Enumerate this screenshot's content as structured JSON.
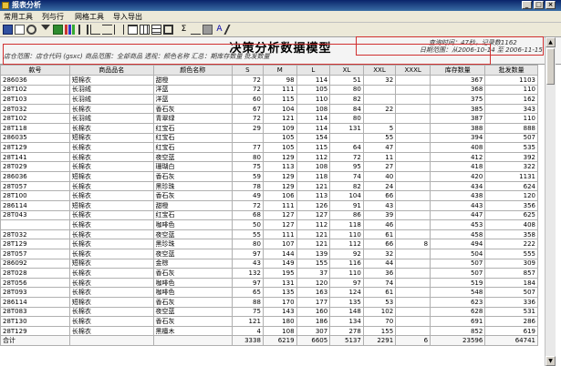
{
  "window": {
    "title": "报表分析"
  },
  "menu": [
    "常用工具",
    "列与行",
    "网格工具",
    "导入导出"
  ],
  "toolbar_icons": [
    "save-icon",
    "print-preview-icon",
    "find-icon",
    "filter-icon",
    "excel-icon",
    "chart-icon",
    "vertical-align-icon",
    "tree-icon",
    "row-height-icon",
    "column-width-icon",
    "table-icon",
    "grid-icon",
    "frame-icon",
    "border-icon",
    "sum-icon",
    "average-icon",
    "calculator-icon",
    "text-icon",
    "pen-icon"
  ],
  "report": {
    "title": "决策分析数据模型",
    "left_info": "店仓范围：店仓代码 (gsxc)    商品范围：全部商品    透视：颜色名称    汇总：期库存数量  批发数量",
    "right_info1": "查询时间：47秒，记录数1162",
    "right_info2": "日期范围：从2006-10-14 至 2006-11-15"
  },
  "table": {
    "headers": [
      "款号",
      "商品品名",
      "颜色名称",
      "S",
      "M",
      "L",
      "XL",
      "XXL",
      "XXXL",
      "库存数量",
      "批发数量"
    ],
    "rows": [
      [
        "286036",
        "短棉衣",
        "甜橙",
        "72",
        "98",
        "114",
        "51",
        "32",
        "",
        "367",
        "1103"
      ],
      [
        "28T102",
        "长羽绒",
        "洋蓝",
        "72",
        "111",
        "105",
        "80",
        "",
        "",
        "368",
        "110"
      ],
      [
        "28T103",
        "长羽绒",
        "洋蓝",
        "60",
        "115",
        "110",
        "82",
        "",
        "",
        "375",
        "162"
      ],
      [
        "28T032",
        "长棉衣",
        "香石灰",
        "67",
        "104",
        "108",
        "84",
        "22",
        "",
        "385",
        "343"
      ],
      [
        "28T102",
        "长羽绒",
        "青翠绿",
        "72",
        "121",
        "114",
        "80",
        "",
        "",
        "387",
        "110"
      ],
      [
        "28T118",
        "长棉衣",
        "红宝石",
        "29",
        "109",
        "114",
        "131",
        "5",
        "",
        "388",
        "888"
      ],
      [
        "286035",
        "短棉衣",
        "红宝石",
        "",
        "105",
        "154",
        "",
        "55",
        "",
        "394",
        "507"
      ],
      [
        "28T129",
        "长棉衣",
        "红宝石",
        "77",
        "105",
        "115",
        "64",
        "47",
        "",
        "408",
        "535"
      ],
      [
        "28T141",
        "长棉衣",
        "夜空蓝",
        "80",
        "129",
        "112",
        "72",
        "11",
        "",
        "412",
        "392"
      ],
      [
        "28T029",
        "长棉衣",
        "珊瑚白",
        "75",
        "113",
        "108",
        "95",
        "27",
        "",
        "418",
        "322"
      ],
      [
        "286036",
        "短棉衣",
        "香石灰",
        "59",
        "129",
        "118",
        "74",
        "40",
        "",
        "420",
        "1131"
      ],
      [
        "28T057",
        "长棉衣",
        "黑珍珠",
        "78",
        "129",
        "121",
        "82",
        "24",
        "",
        "434",
        "624"
      ],
      [
        "28T100",
        "长棉衣",
        "香石灰",
        "49",
        "106",
        "113",
        "104",
        "66",
        "",
        "438",
        "120"
      ],
      [
        "286114",
        "短棉衣",
        "甜橙",
        "72",
        "111",
        "126",
        "91",
        "43",
        "",
        "443",
        "356"
      ],
      [
        "28T043",
        "长棉衣",
        "红宝石",
        "68",
        "127",
        "127",
        "86",
        "39",
        "",
        "447",
        "625"
      ],
      [
        "",
        "长棉衣",
        "咖啡色",
        "50",
        "127",
        "112",
        "118",
        "46",
        "",
        "453",
        "408"
      ],
      [
        "28T032",
        "长棉衣",
        "夜空蓝",
        "55",
        "111",
        "121",
        "110",
        "61",
        "",
        "458",
        "358"
      ],
      [
        "28T129",
        "长棉衣",
        "黑珍珠",
        "80",
        "107",
        "121",
        "112",
        "66",
        "8",
        "494",
        "222"
      ],
      [
        "28T057",
        "长棉衣",
        "夜空蓝",
        "97",
        "144",
        "139",
        "92",
        "32",
        "",
        "504",
        "555"
      ],
      [
        "286092",
        "短棉衣",
        "金棕",
        "43",
        "149",
        "155",
        "116",
        "44",
        "",
        "507",
        "309"
      ],
      [
        "28T028",
        "长棉衣",
        "香石灰",
        "132",
        "195",
        "37",
        "110",
        "36",
        "",
        "507",
        "857"
      ],
      [
        "28T056",
        "长棉衣",
        "咖啡色",
        "97",
        "131",
        "120",
        "97",
        "74",
        "",
        "519",
        "184"
      ],
      [
        "28T093",
        "长棉衣",
        "咖啡色",
        "65",
        "135",
        "163",
        "124",
        "61",
        "",
        "548",
        "507"
      ],
      [
        "286114",
        "短棉衣",
        "香石灰",
        "88",
        "170",
        "177",
        "135",
        "53",
        "",
        "623",
        "336"
      ],
      [
        "28T083",
        "长棉衣",
        "夜空蓝",
        "75",
        "143",
        "160",
        "148",
        "102",
        "",
        "628",
        "531"
      ],
      [
        "28T130",
        "长棉衣",
        "香石灰",
        "121",
        "180",
        "186",
        "134",
        "70",
        "",
        "691",
        "286"
      ],
      [
        "28T129",
        "长棉衣",
        "黑檀木",
        "4",
        "108",
        "307",
        "278",
        "155",
        "",
        "852",
        "619"
      ]
    ],
    "total": [
      "合计",
      "",
      "",
      "3338",
      "6219",
      "6605",
      "5137",
      "2291",
      "6",
      "23596",
      "64741"
    ]
  },
  "colors": {
    "titlebar": "#0a246a",
    "highlight": "#d03030"
  }
}
